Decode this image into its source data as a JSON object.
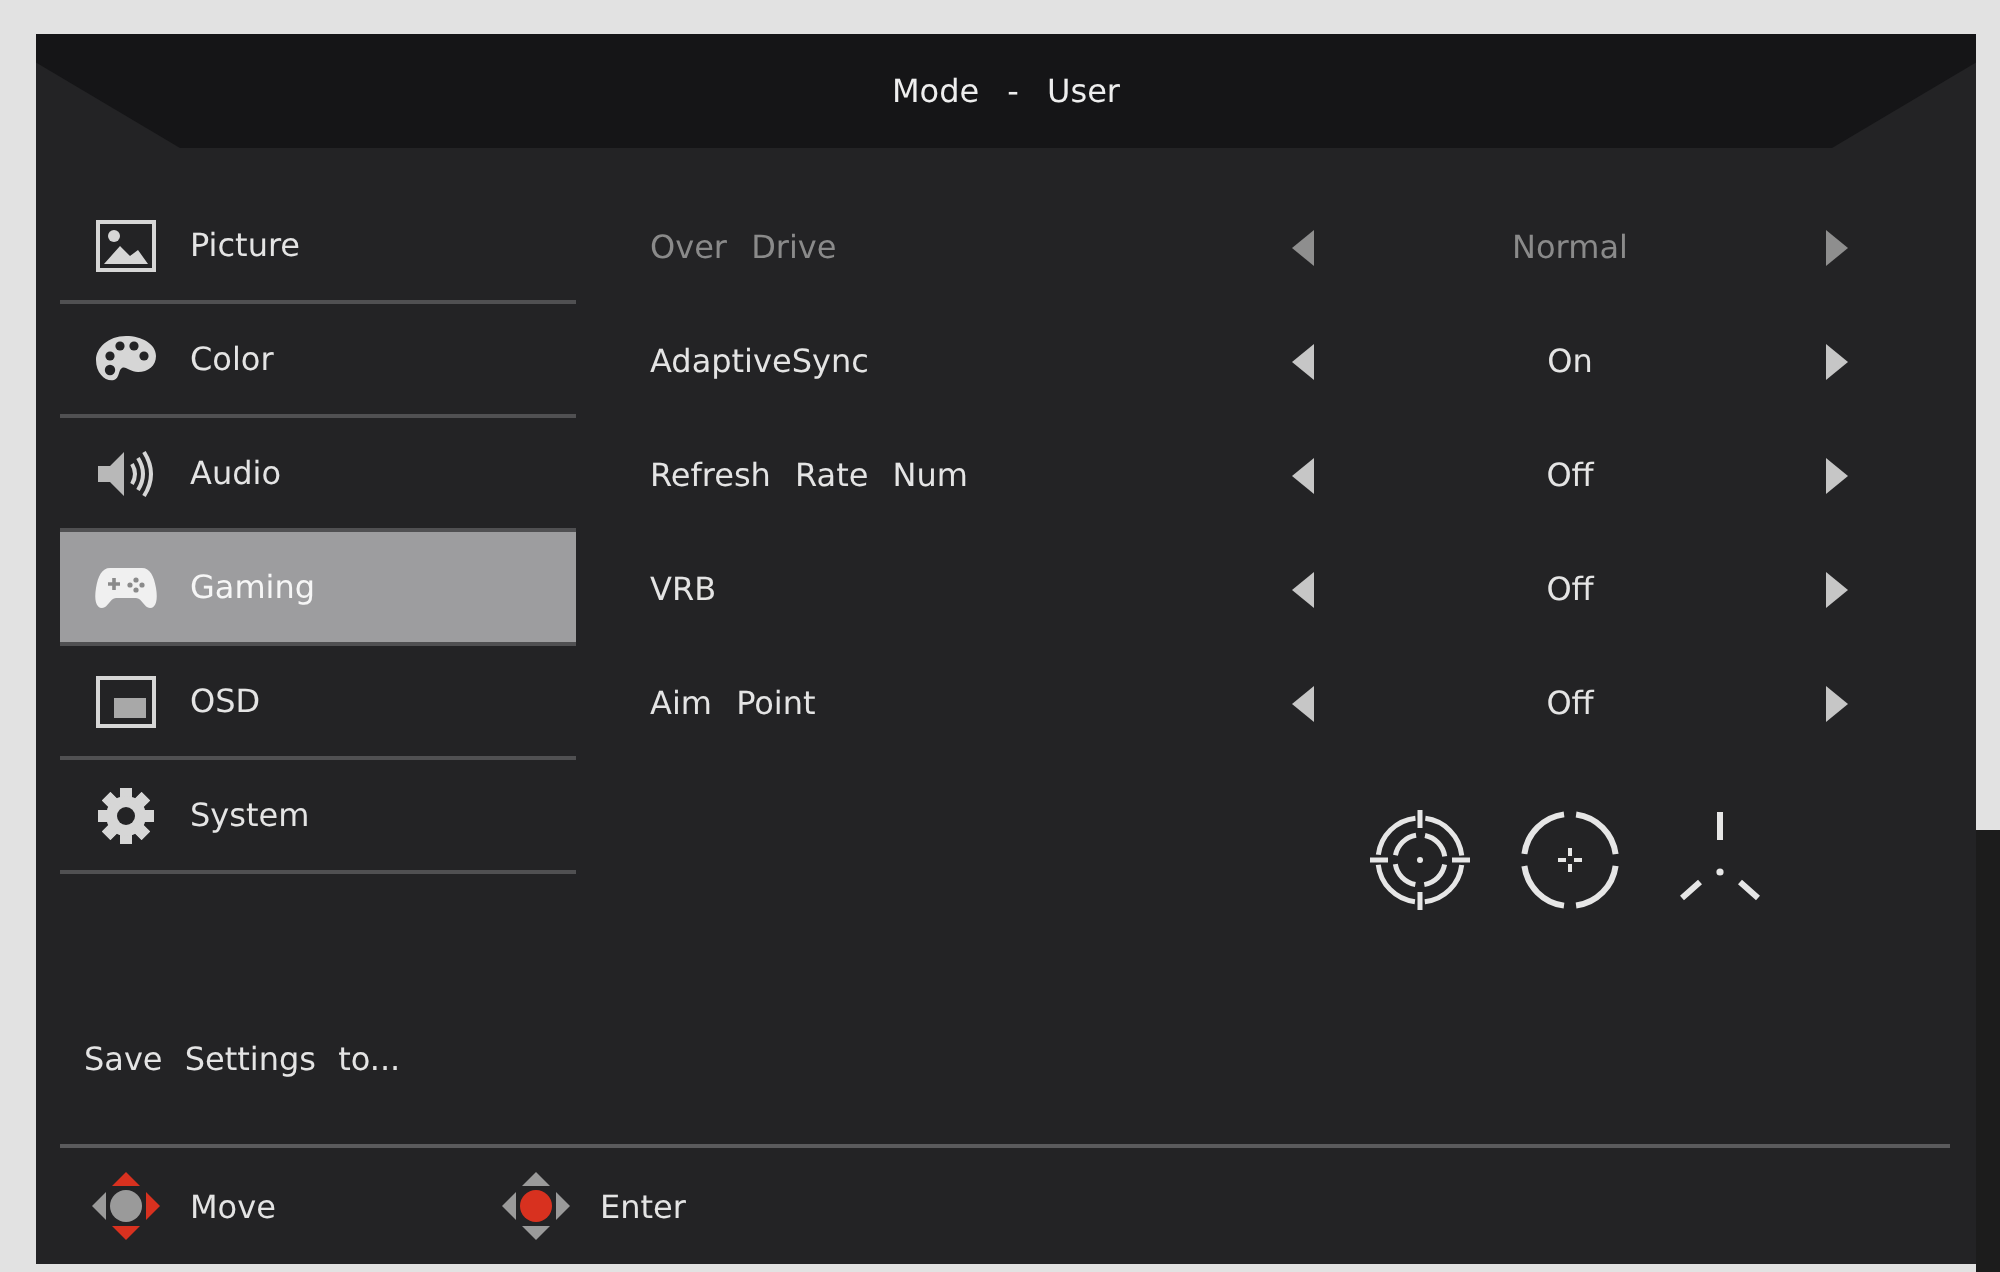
{
  "header": {
    "title": "Mode - User"
  },
  "sidebar": {
    "items": [
      {
        "label": "Picture",
        "kind": "picture",
        "selected": false
      },
      {
        "label": "Color",
        "kind": "color",
        "selected": false
      },
      {
        "label": "Audio",
        "kind": "audio",
        "selected": false
      },
      {
        "label": "Gaming",
        "kind": "gaming",
        "selected": true
      },
      {
        "label": "OSD",
        "kind": "osd",
        "selected": false
      },
      {
        "label": "System",
        "kind": "system",
        "selected": false
      }
    ],
    "save_item": "Save Settings to..."
  },
  "settings": [
    {
      "label": "Over Drive",
      "value": "Normal",
      "disabled": true
    },
    {
      "label": "AdaptiveSync",
      "value": "On",
      "disabled": false
    },
    {
      "label": "Refresh Rate Num",
      "value": "Off",
      "disabled": false
    },
    {
      "label": "VRB",
      "value": "Off",
      "disabled": false
    },
    {
      "label": "Aim Point",
      "value": "Off",
      "disabled": false
    }
  ],
  "footer": {
    "hints": [
      {
        "label": "Move",
        "kind": "move"
      },
      {
        "label": "Enter",
        "kind": "enter"
      }
    ]
  }
}
